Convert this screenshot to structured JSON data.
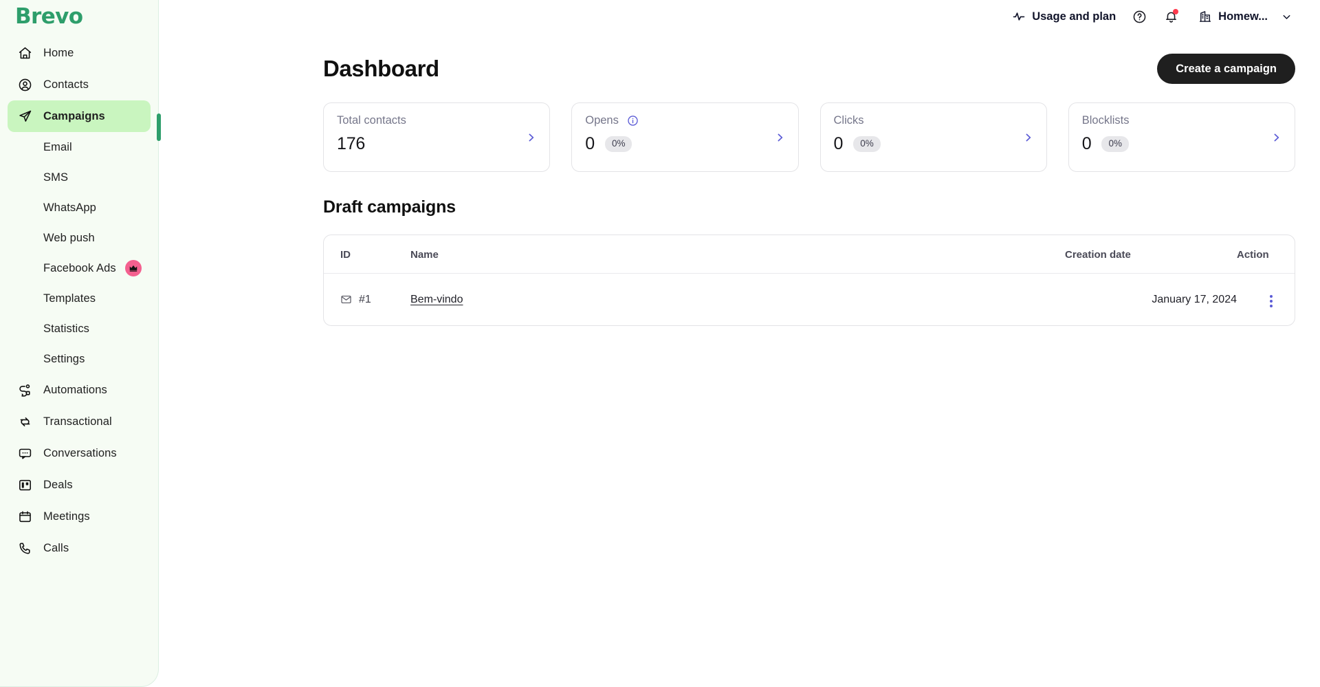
{
  "brand": {
    "name": "Brevo",
    "color": "#2e9e6b"
  },
  "sidebar": {
    "items": [
      {
        "label": "Home",
        "icon": "home-icon"
      },
      {
        "label": "Contacts",
        "icon": "contacts-icon"
      },
      {
        "label": "Campaigns",
        "icon": "send-icon",
        "active": true
      },
      {
        "label": "Automations",
        "icon": "automations-icon"
      },
      {
        "label": "Transactional",
        "icon": "transactional-icon"
      },
      {
        "label": "Conversations",
        "icon": "conversations-icon"
      },
      {
        "label": "Deals",
        "icon": "deals-icon"
      },
      {
        "label": "Meetings",
        "icon": "calendar-icon"
      },
      {
        "label": "Calls",
        "icon": "phone-icon"
      }
    ],
    "sub_items": [
      {
        "label": "Email"
      },
      {
        "label": "SMS"
      },
      {
        "label": "WhatsApp"
      },
      {
        "label": "Web push"
      },
      {
        "label": "Facebook Ads",
        "badge": "crown-icon",
        "badge_color": "#f4608f"
      },
      {
        "label": "Templates"
      },
      {
        "label": "Statistics"
      },
      {
        "label": "Settings"
      }
    ]
  },
  "topbar": {
    "usage_label": "Usage and plan",
    "usage_icon": "activity-icon",
    "help_icon": "help-circle-icon",
    "notifications_icon": "bell-icon",
    "notifications_has_alert": true,
    "org_icon": "building-icon",
    "org_label": "Homew...",
    "org_caret_icon": "chevron-down-icon"
  },
  "main": {
    "page_title": "Dashboard",
    "create_campaign_label": "Create a campaign",
    "stats": [
      {
        "label": "Total contacts",
        "value": "176",
        "pct": null,
        "info": false,
        "chevron": "chevron-right-icon"
      },
      {
        "label": "Opens",
        "value": "0",
        "pct": "0%",
        "info": true,
        "chevron": "chevron-right-icon"
      },
      {
        "label": "Clicks",
        "value": "0",
        "pct": "0%",
        "info": false,
        "chevron": "chevron-right-icon"
      },
      {
        "label": "Blocklists",
        "value": "0",
        "pct": "0%",
        "info": false,
        "chevron": "chevron-right-icon"
      }
    ],
    "section_title": "Draft campaigns",
    "table": {
      "columns": [
        "ID",
        "Name",
        "Creation date",
        "Action"
      ],
      "rows": [
        {
          "id": "#1",
          "id_icon": "envelope-icon",
          "name": "Bem-vindo",
          "creation_date": "January 17, 2024",
          "action_icon": "kebab-menu-icon"
        }
      ]
    }
  },
  "colors": {
    "sidebar_bg": "#f6fcf4",
    "active_nav_bg": "#c9f5bf",
    "accent_purple": "#5b5bd6",
    "brand_green": "#2e9e6b",
    "badge_pink": "#f4608f",
    "alert_red": "#ff3b4e"
  }
}
